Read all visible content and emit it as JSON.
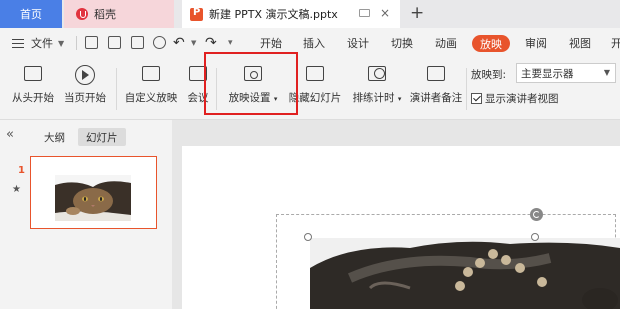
{
  "tabs": {
    "home": "首页",
    "daoke": "稻壳",
    "document": "新建 PPTX 演示文稿.pptx"
  },
  "menu": {
    "file": "文件",
    "tabs": [
      "开始",
      "插入",
      "设计",
      "切换",
      "动画",
      "放映",
      "审阅",
      "视图",
      "开"
    ],
    "active_tab": "放映"
  },
  "ribbon": {
    "from_start": "从头开始",
    "from_current": "当页开始",
    "custom_show": "自定义放映",
    "meeting": "会议",
    "show_settings": "放映设置",
    "hide_slide": "隐藏幻灯片",
    "rehearse": "排练计时",
    "speaker_notes": "演讲者备注",
    "play_to_label": "放映到:",
    "play_to_value": "主要显示器",
    "presenter_view": "显示演讲者视图"
  },
  "panel": {
    "outline_tab": "大纲",
    "slides_tab": "幻灯片",
    "slide_number": "1"
  },
  "colors": {
    "accent": "#e8542c",
    "home_tab": "#4a7fe6",
    "highlight": "#e02020"
  }
}
